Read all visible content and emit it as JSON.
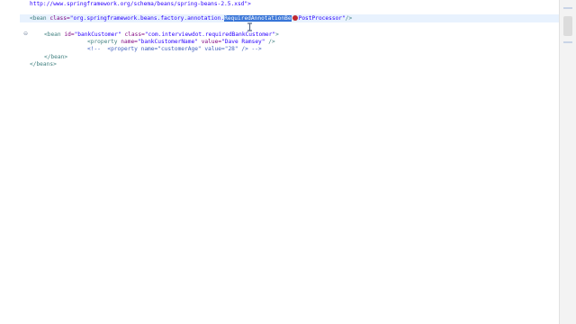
{
  "editor": {
    "lines": {
      "schema_url": "http://www.springframework.org/schema/beans/spring-beans-2.5.xsd\">",
      "bean1_open": "<bean",
      "bean1_class_attr": "class=",
      "bean1_class_pre": "\"org.springframework.beans.factory.annotation.",
      "bean1_class_sel": "RequiredAnnotationBe",
      "bean1_class_post": "PostProcessor\"",
      "bean1_close": "/>",
      "bean2_open": "<bean",
      "bean2_id_attr": "id=",
      "bean2_id_val": "\"bankCustomer\"",
      "bean2_class_attr": "class=",
      "bean2_class_val": "\"com.interviewdot.requiredBankCustomer\"",
      "bean2_close": ">",
      "prop1_open": "<property",
      "prop1_name_attr": "name=",
      "prop1_name_val": "\"bankCustomerName\"",
      "prop1_value_attr": "value=",
      "prop1_value_val": "\"Dave Ramsey\"",
      "prop1_close": "/>",
      "comment_line": "<!--  <property name=\"customerAge\" value=\"28\" /> -->",
      "bean2_end": "</bean>",
      "beans_end": "</beans>"
    },
    "fold_marker": "⊖"
  }
}
